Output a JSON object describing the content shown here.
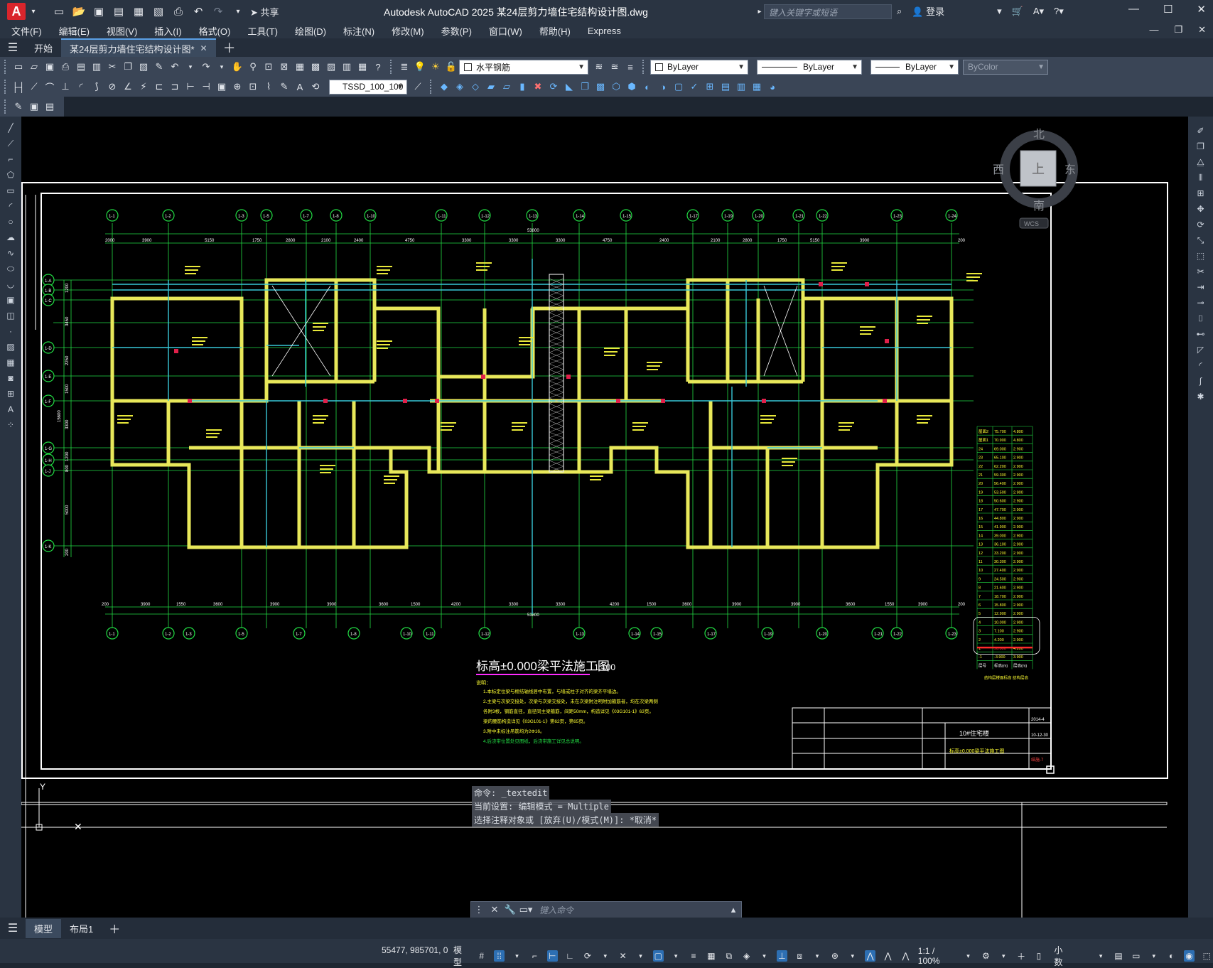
{
  "window": {
    "title": "Autodesk AutoCAD 2025    某24层剪力墙住宅结构设计图.dwg",
    "logo": "A",
    "share_label": "共享",
    "search_placeholder": "键入关键字或短语",
    "login_label": "登录"
  },
  "menu": [
    "文件(F)",
    "编辑(E)",
    "视图(V)",
    "插入(I)",
    "格式(O)",
    "工具(T)",
    "绘图(D)",
    "标注(N)",
    "修改(M)",
    "参数(P)",
    "窗口(W)",
    "帮助(H)",
    "Express"
  ],
  "tabs": {
    "start": "开始",
    "active": "某24层剪力墙住宅结构设计图*"
  },
  "toolbar": {
    "layer_name": "水平钢筋",
    "color": "ByLayer",
    "linetype": "ByLayer",
    "lineweight": "ByLayer",
    "plotstyle": "ByColor",
    "dimstyle": "TSSD_100_100"
  },
  "navcube": {
    "north": "北",
    "south": "南",
    "east": "东",
    "west": "西",
    "top": "上",
    "wcs": "WCS"
  },
  "drawing": {
    "title": "标高±0.000梁平法施工图",
    "scale": "1:100",
    "notes_header": "说明：",
    "notes": [
      "1.本标定位梁与框结轴线居中布置，与墙或柱子对齐的梁齐平墙边。",
      "2.主梁与次梁交接处，次梁与次梁交接处，未在次梁附注明附加箍筋者，均在次梁两侧",
      "各附3根，钢筋直径，直径同主梁箍筋，间距50mm，构造详见《03G101-1》63页。",
      "梁的腰筋构造详见《03G101-1》第62页，第65页。",
      "3.附中未标注吊筋均为2Φ16。",
      "4.后浇带位置处见图纸，后浇带施工详见总说明。"
    ],
    "top_total_dim": "53800",
    "bottom_total_dim": "53800",
    "top_dims": [
      "2000",
      "3900",
      "5150",
      "1750",
      "2800",
      "2100",
      "2400",
      "4750",
      "3300",
      "3300",
      "3300",
      "4750",
      "2400",
      "2100",
      "2800",
      "1750",
      "5150",
      "3900",
      "200"
    ],
    "bottom_dims": [
      "200",
      "3900",
      "1550",
      "3600",
      "3900",
      "3900",
      "3600",
      "1500",
      "4200",
      "3300",
      "3300",
      "4200",
      "1500",
      "3600",
      "3900",
      "3900",
      "3600",
      "1550",
      "3900",
      "200"
    ],
    "left_dims": [
      "1200",
      "3450",
      "2250",
      "1500",
      "3300",
      "1200",
      "800",
      "5000",
      "200"
    ],
    "left_total_dim": "15600",
    "top_axes": [
      "1-1",
      "1-2",
      "1-3",
      "1-5",
      "1-7",
      "1-8",
      "1-10",
      "1-11",
      "1-12",
      "1-13",
      "1-14",
      "1-15",
      "1-17",
      "1-19",
      "1-20",
      "1-21",
      "1-22",
      "1-23",
      "1-24"
    ],
    "left_axes": [
      "1-A",
      "1-B",
      "1-C",
      "1-D",
      "1-E",
      "1-F",
      "1-G",
      "1-H",
      "1-J",
      "1-K"
    ]
  },
  "floor_table": {
    "headers": [
      "层号",
      "标高(m)",
      "层高(m)"
    ],
    "rows": [
      [
        "屋面2",
        "75.700",
        "4.800"
      ],
      [
        "屋面1",
        "70.900",
        "4.800"
      ],
      [
        "24",
        "69.000",
        "2.900"
      ],
      [
        "23",
        "65.100",
        "2.900"
      ],
      [
        "22",
        "62.200",
        "2.900"
      ],
      [
        "21",
        "59.300",
        "2.900"
      ],
      [
        "20",
        "56.400",
        "2.900"
      ],
      [
        "19",
        "53.500",
        "2.900"
      ],
      [
        "18",
        "50.600",
        "2.900"
      ],
      [
        "17",
        "47.700",
        "2.900"
      ],
      [
        "16",
        "44.800",
        "2.900"
      ],
      [
        "15",
        "41.900",
        "2.900"
      ],
      [
        "14",
        "39.000",
        "2.900"
      ],
      [
        "13",
        "36.100",
        "2.900"
      ],
      [
        "12",
        "33.200",
        "2.900"
      ],
      [
        "11",
        "30.300",
        "2.900"
      ],
      [
        "10",
        "27.400",
        "2.900"
      ],
      [
        "9",
        "24.500",
        "2.900"
      ],
      [
        "8",
        "21.600",
        "2.900"
      ],
      [
        "7",
        "18.700",
        "2.900"
      ],
      [
        "6",
        "15.800",
        "2.900"
      ],
      [
        "5",
        "12.900",
        "2.900"
      ],
      [
        "4",
        "10.000",
        "2.900"
      ],
      [
        "3",
        "7.100",
        "2.900"
      ],
      [
        "2",
        "4.200",
        "2.900"
      ],
      [
        "1",
        "±0.000",
        "4.200"
      ],
      [
        "-1",
        "-3.900",
        "3.900"
      ]
    ],
    "caption": "结构层楼面标高  结构层高"
  },
  "titleblock": {
    "project": "10#住宅楼",
    "drawing_name": "标高±0.000梁平法施工图",
    "code": "2014-4",
    "date": "10-12-30",
    "sheet": "结施-7"
  },
  "command": {
    "history": [
      "命令: _textedit",
      "当前设置: 编辑模式 = Multiple",
      "选择注释对象或 [放弃(U)/模式(M)]: *取消*"
    ],
    "placeholder": "键入命令"
  },
  "layouts": {
    "model": "模型",
    "layout1": "布局1"
  },
  "status": {
    "coords": "55477, 985701, 0",
    "space": "模型",
    "scale": "1:1 / 100%",
    "units": "小数"
  }
}
